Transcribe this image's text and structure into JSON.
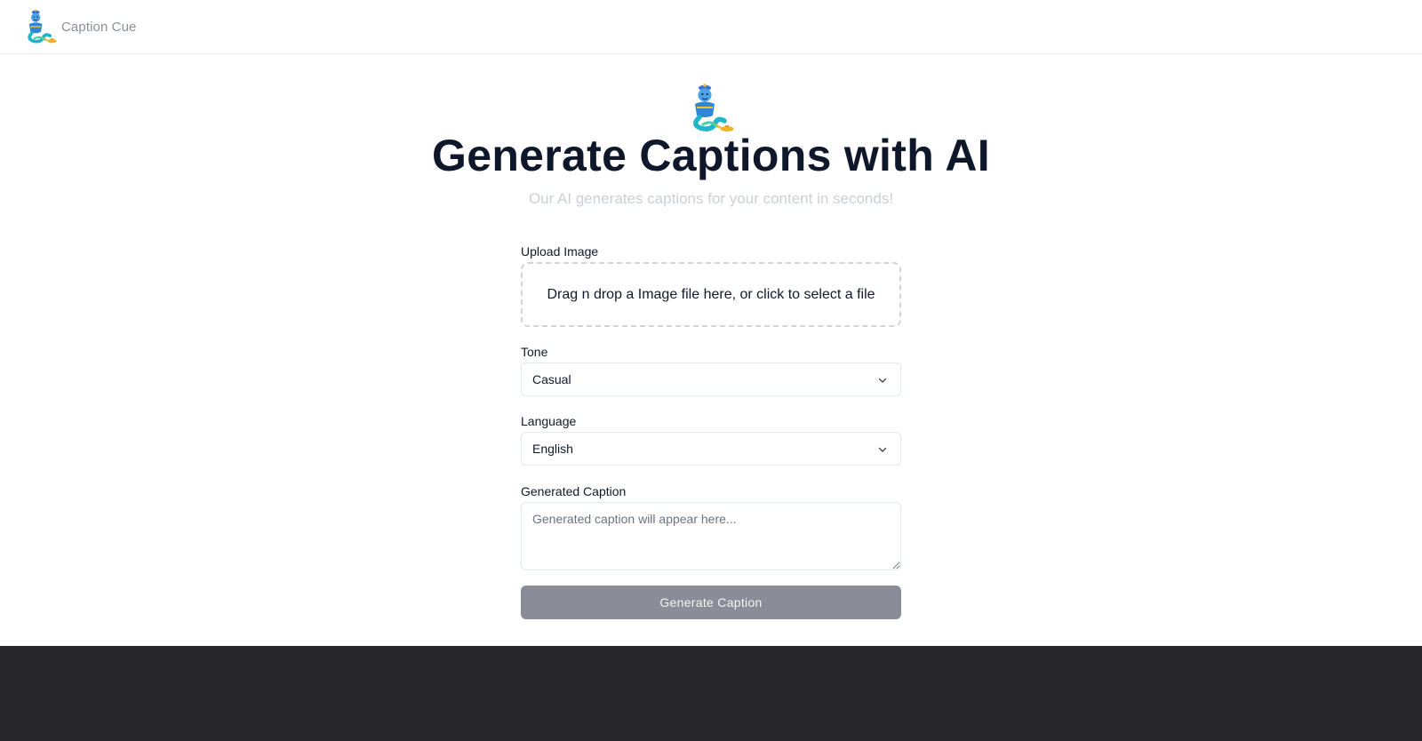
{
  "navbar": {
    "brand_name": "Caption Cue",
    "logo_icon": "genie-lamp-icon"
  },
  "hero": {
    "logo_icon": "genie-lamp-icon",
    "title": "Generate Captions with AI",
    "subtitle": "Our AI generates captions for your content in seconds!"
  },
  "form": {
    "upload": {
      "label": "Upload Image",
      "dropzone_text": "Drag n drop a Image file here, or click to select a file"
    },
    "tone": {
      "label": "Tone",
      "selected": "Casual"
    },
    "language": {
      "label": "Language",
      "selected": "English"
    },
    "caption": {
      "label": "Generated Caption",
      "placeholder": "Generated caption will appear here...",
      "value": ""
    },
    "generate_button": "Generate Caption"
  },
  "colors": {
    "button_bg": "#8a8d97",
    "footer_bg": "#27272a",
    "title_text": "#0f172a",
    "subtitle_text": "#cbd0d6"
  }
}
